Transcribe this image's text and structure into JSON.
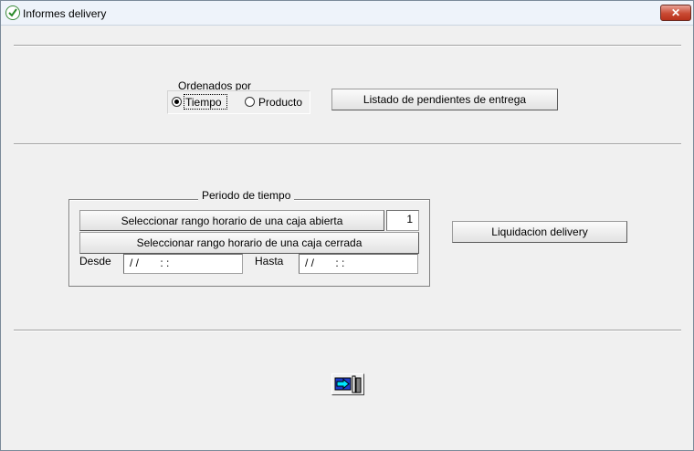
{
  "window": {
    "title": "Informes delivery",
    "close_glyph": "✕"
  },
  "ordering": {
    "label": "Ordenados por",
    "options": [
      {
        "label": "Tiempo",
        "selected": true
      },
      {
        "label": "Producto",
        "selected": false
      }
    ]
  },
  "buttons": {
    "pending_list": "Listado de pendientes de entrega",
    "open_range": "Seleccionar rango horario de una caja abierta",
    "closed_range": "Seleccionar rango horario de una caja cerrada",
    "liquidation": "Liquidacion delivery"
  },
  "period": {
    "title": "Periodo de tiempo",
    "box_number": "1",
    "from_label": "Desde",
    "from_value": "/ /       : :",
    "to_label": "Hasta",
    "to_value": "/ /       : :"
  },
  "icons": {
    "app": "app-icon",
    "exit": "exit-door-icon"
  },
  "colors": {
    "background": "#f0f0f0",
    "close_button": "#c94a33",
    "exit_arrow": "#1e3cc8"
  }
}
